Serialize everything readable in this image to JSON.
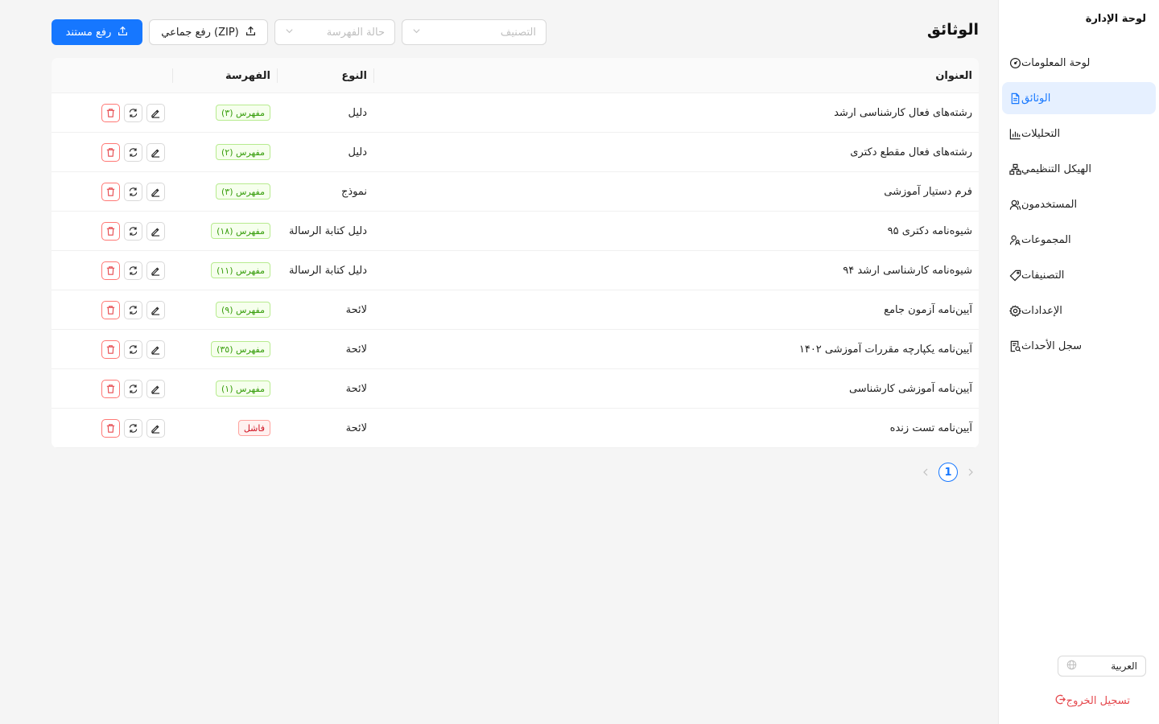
{
  "sidebar": {
    "title": "لوحة الإدارة",
    "items": [
      {
        "label": "لوحة المعلومات",
        "icon": "dashboard-icon",
        "active": false
      },
      {
        "label": "الوثائق",
        "icon": "document-icon",
        "active": true
      },
      {
        "label": "التحليلات",
        "icon": "bar-chart-icon",
        "active": false
      },
      {
        "label": "الهيكل التنظيمي",
        "icon": "org-chart-icon",
        "active": false
      },
      {
        "label": "المستخدمون",
        "icon": "users-icon",
        "active": false
      },
      {
        "label": "المجموعات",
        "icon": "groups-icon",
        "active": false
      },
      {
        "label": "التصنيفات",
        "icon": "tag-icon",
        "active": false
      },
      {
        "label": "الإعدادات",
        "icon": "gear-icon",
        "active": false
      },
      {
        "label": "سجل الأحداث",
        "icon": "audit-log-icon",
        "active": false
      }
    ],
    "language": "العربية",
    "logout": "تسجيل الخروج"
  },
  "page": {
    "title": "الوثائق"
  },
  "toolbar": {
    "upload_label": "رفع مستند",
    "bulk_upload_label": "رفع جماعي (ZIP)",
    "status_placeholder": "حالة الفهرسة",
    "category_placeholder": "التصنيف"
  },
  "table": {
    "columns": {
      "title": "العنوان",
      "type": "النوع",
      "index": "الفهرسة"
    },
    "rows": [
      {
        "title": "رشته‌های فعال کارشناسی ارشد",
        "type": "دليل",
        "index": "مفهرس (٣)",
        "status": "ok"
      },
      {
        "title": "رشته‌های فعال مقطع دکتری",
        "type": "دليل",
        "index": "مفهرس (٢)",
        "status": "ok"
      },
      {
        "title": "فرم دستیار آموزشی",
        "type": "نموذج",
        "index": "مفهرس (٣)",
        "status": "ok"
      },
      {
        "title": "شیوه‌نامه دکتری ۹۵",
        "type": "دليل كتابة الرسالة",
        "index": "مفهرس (١٨)",
        "status": "ok"
      },
      {
        "title": "شیوه‌نامه کارشناسی ارشد ۹۴",
        "type": "دليل كتابة الرسالة",
        "index": "مفهرس (١١)",
        "status": "ok"
      },
      {
        "title": "آیین‌نامه آزمون جامع",
        "type": "لائحة",
        "index": "مفهرس (٩)",
        "status": "ok"
      },
      {
        "title": "آیین‌نامه یکپارچه مقررات آموزشی ۱۴۰۲",
        "type": "لائحة",
        "index": "مفهرس (٣٥)",
        "status": "ok"
      },
      {
        "title": "آیین‌نامه آموزشی کارشناسی",
        "type": "لائحة",
        "index": "مفهرس (١)",
        "status": "ok"
      },
      {
        "title": "آیین‌نامه تست زنده",
        "type": "لائحة",
        "index": "فاشل",
        "status": "fail"
      }
    ]
  },
  "pagination": {
    "current_page": "1"
  },
  "colors": {
    "primary": "#1677ff",
    "success": "#389e0d",
    "danger": "#e5484d",
    "active_bg": "#e6f0ff"
  }
}
